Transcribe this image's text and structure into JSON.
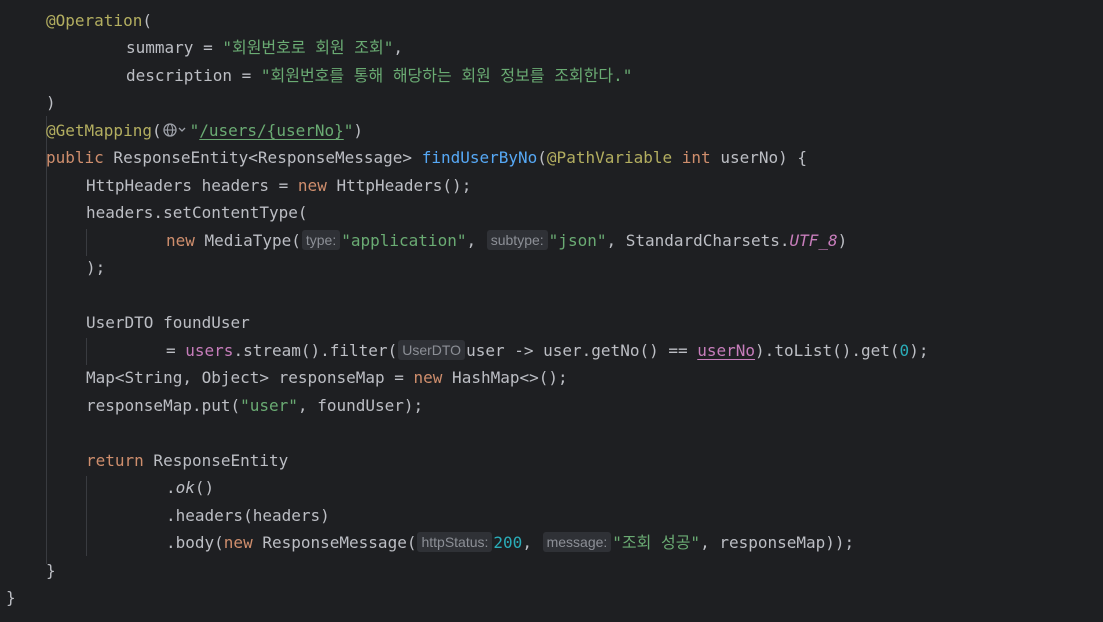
{
  "colors": {
    "background": "#1e1f22",
    "default_text": "#bcbec4",
    "keyword": "#cf8e6d",
    "annotation": "#b3ae60",
    "string": "#6aab73",
    "number": "#2aacb8",
    "method_declaration": "#56a8f5",
    "field": "#c77dbb",
    "inlay_hint_bg": "#2f3136",
    "inlay_hint_text": "#8c8f96"
  },
  "code": {
    "l1": {
      "annotation": "@Operation",
      "paren": "("
    },
    "l2": {
      "key": "summary",
      "op": " = ",
      "value": "\"회원번호로 회원 조회\"",
      "comma": ","
    },
    "l3": {
      "key": "description",
      "op": " = ",
      "value": "\"회원번호를 통해 해당하는 회원 정보를 조회한다.\""
    },
    "l4": {
      "paren": ")"
    },
    "l5": {
      "annotation": "@GetMapping",
      "open": "(",
      "quote_open": "\"",
      "path": "/users/{userNo}",
      "quote_close": "\"",
      "close": ")"
    },
    "l6": {
      "kw_public": "public",
      "return_type": " ResponseEntity<ResponseMessage> ",
      "method": "findUserByNo",
      "open": "(",
      "annotation": "@PathVariable",
      "kw_int": " int",
      "param": " userNo) {"
    },
    "l7": {
      "type": "HttpHeaders headers = ",
      "kw_new": "new",
      "rest": " HttpHeaders();"
    },
    "l8": {
      "text": "headers.setContentType("
    },
    "l9": {
      "kw_new": "new",
      "call": " MediaType(",
      "hint_type": "type:",
      "str_type": "\"application\"",
      "sep": ", ",
      "hint_subtype": "subtype:",
      "str_subtype": "\"json\"",
      "mid": ", StandardCharsets.",
      "const": "UTF_8",
      "close": ")"
    },
    "l10": {
      "text": ");"
    },
    "l12": {
      "text": "UserDTO foundUser"
    },
    "l13": {
      "eq": "= ",
      "field": "users",
      "chain": ".stream().filter(",
      "hint_type": "UserDTO",
      "lambda": "user -> user.getNo() == ",
      "param_ref": "userNo",
      "chain2": ").toList().get(",
      "num": "0",
      "end": ");"
    },
    "l14": {
      "text": "Map<String, Object> responseMap = ",
      "kw_new": "new",
      "rest": " HashMap<>();"
    },
    "l15": {
      "text": "responseMap.put(",
      "str": "\"user\"",
      "rest": ", foundUser);"
    },
    "l17": {
      "kw_return": "return",
      "rest": " ResponseEntity"
    },
    "l18": {
      "dot": ".",
      "method": "ok",
      "rest": "()"
    },
    "l19": {
      "text": ".headers(headers)"
    },
    "l20": {
      "text": ".body(",
      "kw_new": "new",
      "call": " ResponseMessage(",
      "hint_status": "httpStatus:",
      "num": "200",
      "sep": ", ",
      "hint_message": "message:",
      "str": "\"조회 성공\"",
      "rest": ", responseMap));"
    },
    "l21": {
      "text": "}"
    },
    "l22": {
      "text": "}"
    }
  }
}
